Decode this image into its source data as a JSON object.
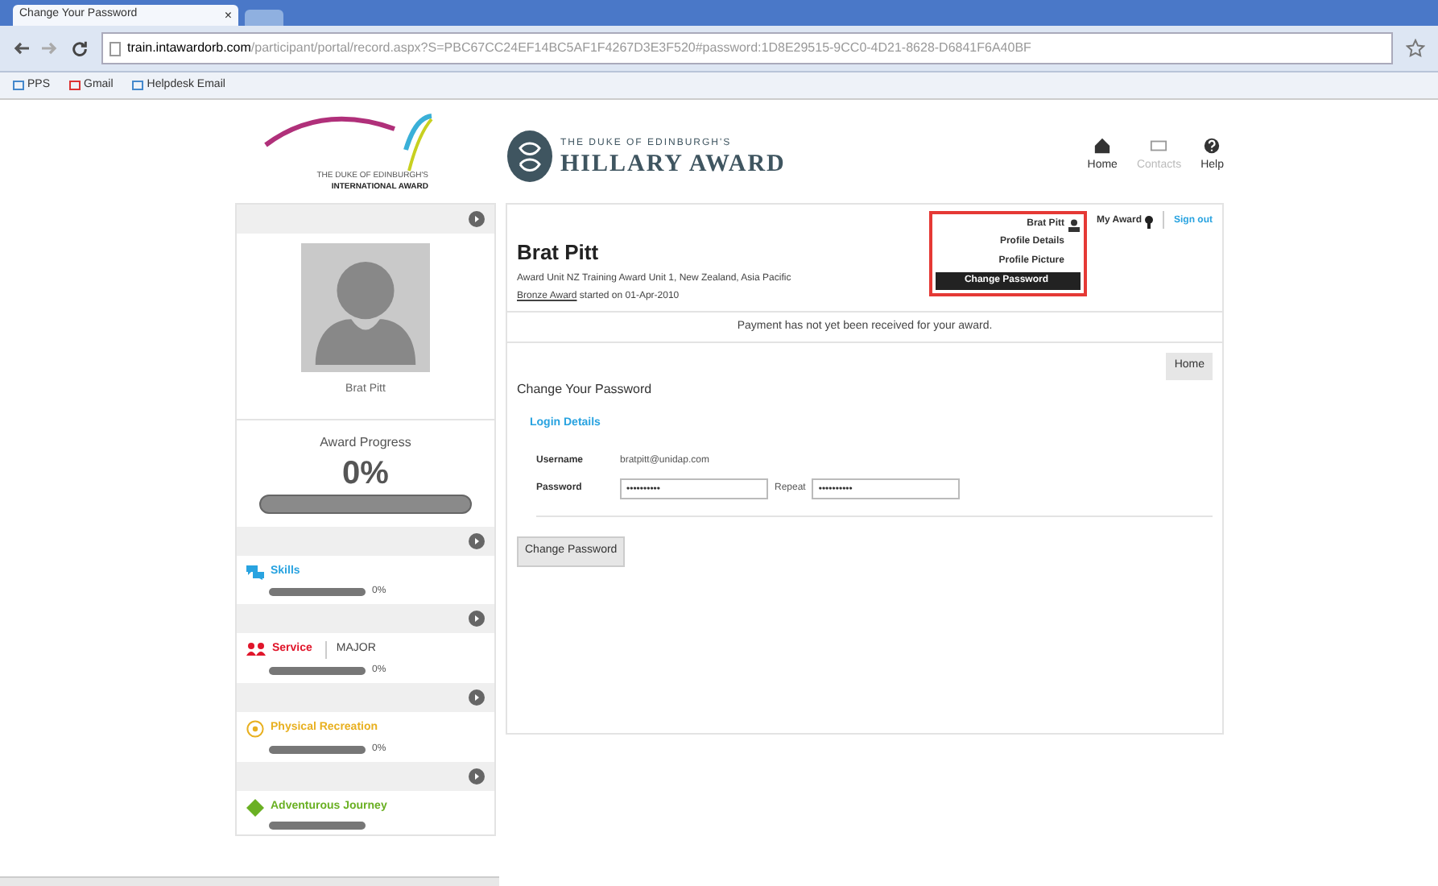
{
  "browser": {
    "tabs": [
      {
        "label": "Change Your Password",
        "selected": true
      },
      {
        "selected": false
      }
    ],
    "tab_close": "×",
    "url_host": "train.intawardorb.com",
    "url_path": "/participant/portal/record.aspx?S=PBC67CC24EF14BC5AF1F4267D3E3F520#password:1D8E29515-9CC0-4D21-8628-D6841F6A40BF",
    "bookmarks": [
      "PPS",
      "Gmail",
      "Helpdesk Email"
    ]
  },
  "header": {
    "intl_logo": [
      "THE DUKE OF EDINBURGH'S",
      "INTERNATIONAL AWARD"
    ],
    "hillary_logo": [
      "THE DUKE OF EDINBURGH'S",
      "HILLARY AWARD"
    ],
    "nav": [
      {
        "label": "Home",
        "disabled": false
      },
      {
        "label": "Contacts",
        "disabled": true
      },
      {
        "label": "Help",
        "disabled": false
      }
    ]
  },
  "sidebar": {
    "name": "Brat Pitt",
    "progress_title": "Award Progress",
    "progress_value": "0%",
    "progress": {
      "level": 0
    },
    "sections": [
      {
        "kind": "skills",
        "label": "Skills",
        "color": "#29a3e0",
        "level": 0,
        "reading": "0%"
      },
      {
        "kind": "service",
        "label": "Service",
        "color": "#e0162b",
        "tag": "MAJOR",
        "level": 0,
        "reading": "0%"
      },
      {
        "kind": "recreation",
        "label": "Physical Recreation",
        "color": "#e8b020",
        "level": 0,
        "reading": "0%"
      },
      {
        "kind": "journey",
        "label": "Adventurous Journey",
        "color": "#6ab023",
        "level": 0
      }
    ]
  },
  "profile": {
    "name": "Brat Pitt",
    "unit": "Award Unit NZ Training Award Unit 1, New Zealand, Asia Pacific",
    "award_link": "Bronze Award",
    "started": "started on 01-Apr-2010",
    "menu": {
      "user": "Brat Pitt",
      "items": [
        {
          "label": "Profile Details",
          "selected": false
        },
        {
          "label": "Profile Picture",
          "selected": false
        },
        {
          "label": "Change Password",
          "selected": true
        }
      ]
    },
    "my_award": "My Award",
    "sign_out": "Sign out"
  },
  "notice": "Payment has not yet been received for your award.",
  "form": {
    "home_button": "Home",
    "title": "Change Your Password",
    "section": "Login Details",
    "username_label": "Username",
    "username": "bratpitt@unidap.com",
    "password_label": "Password",
    "password": "••••••••••",
    "repeat_label": "Repeat",
    "repeat": "••••••••••",
    "submit": "Change Password"
  }
}
